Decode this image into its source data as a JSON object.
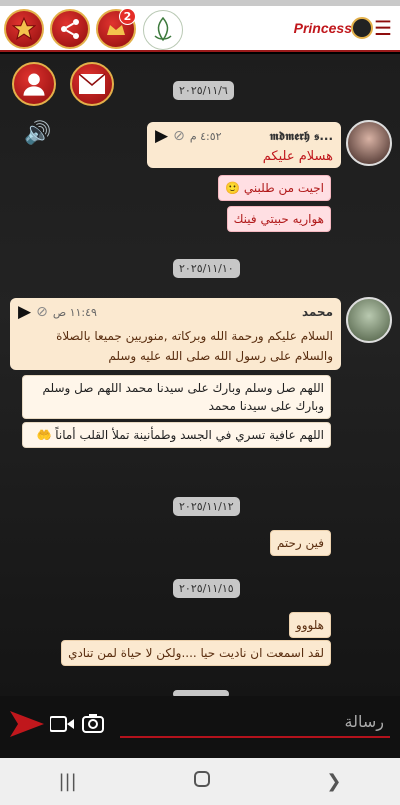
{
  "header": {
    "brand": "Princess",
    "badge_count": "2",
    "menu_icon": "menu-icon",
    "icons": [
      "star-icon",
      "share-icon",
      "notification-icon",
      "group-logo"
    ]
  },
  "side": {
    "icons": [
      "profile-icon",
      "mail-icon",
      "speaker-icon"
    ]
  },
  "chat": {
    "dates": [
      "٢٠٢٥/١١/٦",
      "٢٠٢٥/١١/١٠",
      "٢٠٢٥/١١/١٢",
      "٢٠٢٥/١١/١٥"
    ],
    "post1": {
      "sender": "𝖒𝖉𝖒𝖊𝖗𝖍 𝖘...",
      "time": "٤:٥٢ م",
      "text": "هسلام عليكم",
      "replies": [
        "اجيت من طلبني 🙂",
        "هواريه حبيتي فينك"
      ]
    },
    "post2": {
      "sender": "محمد",
      "time": "١١:٤٩ ص",
      "text": "السلام عليكم ورحمة الله وبركاته ,منوريين جميعا بالصلاة والسلام على رسول الله صلى الله عليه وسلم",
      "replies": [
        "اللهم صل وسلم وبارك على سيدنا محمد اللهم صل وسلم وبارك على سيدنا محمد",
        "اللهم عافية تسري في الجسد وطمأنينة تملأ القلب أماناً 🤲"
      ]
    },
    "post3": {
      "text": "فين رحتم"
    },
    "post4": {
      "lines": [
        "هلووو",
        "لقد اسمعت ان ناديت حيا ....ولكن لا حياة لمن تنادي"
      ]
    }
  },
  "input": {
    "placeholder": "رسالة"
  },
  "colors": {
    "accent": "#c0171c",
    "gold": "#e3b04a"
  }
}
